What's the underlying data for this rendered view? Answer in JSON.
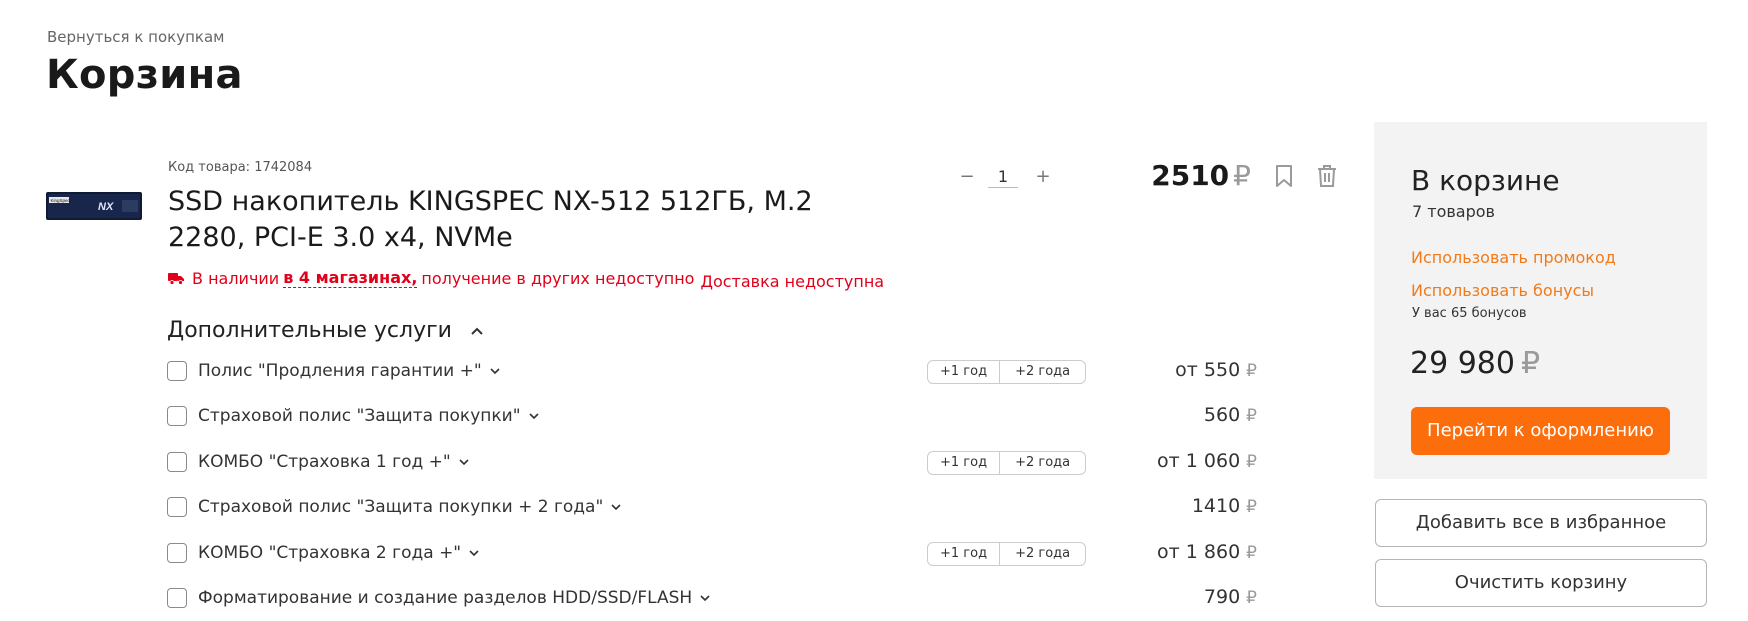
{
  "header": {
    "back_link": "Вернуться к покупкам",
    "title": "Корзина"
  },
  "product": {
    "code": "Код товара: 1742084",
    "name": "SSD накопитель KINGSPEC NX-512 512ГБ, M.2 2280, PCI-E 3.0 x4, NVMe",
    "availability": {
      "prefix": "В наличии",
      "stores_link": "в 4 магазинах,",
      "suffix": "получение в других недоступно",
      "delivery": "Доставка недоступна"
    },
    "image_brand": "KingSpec",
    "image_model": "NX",
    "quantity": "1",
    "qty_minus": "−",
    "qty_plus": "+",
    "price": "2510",
    "currency": "₽"
  },
  "services": {
    "title": "Дополнительные услуги",
    "items": [
      {
        "label": "Полис \"Продления гарантии +\"",
        "options": [
          "+1 год",
          "+2 года"
        ],
        "price": "от 550"
      },
      {
        "label": "Страховой полис \"Защита покупки\"",
        "options": [],
        "price": "560"
      },
      {
        "label": "КОМБО \"Страховка 1 год +\"",
        "options": [
          "+1 год",
          "+2 года"
        ],
        "price": "от 1 060"
      },
      {
        "label": "Страховой полис \"Защита покупки + 2 года\"",
        "options": [],
        "price": "1410"
      },
      {
        "label": "КОМБО \"Страховка 2 года +\"",
        "options": [
          "+1 год",
          "+2 года"
        ],
        "price": "от 1 860"
      },
      {
        "label": "Форматирование и создание разделов HDD/SSD/FLASH",
        "options": [],
        "price": "790"
      }
    ]
  },
  "summary": {
    "title": "В корзине",
    "count": "7 товаров",
    "promo_link": "Использовать промокод",
    "bonus_link": "Использовать бонусы",
    "bonus_info": "У вас 65 бонусов",
    "total": "29 980",
    "checkout_button": "Перейти к оформлению",
    "favorite_all_button": "Добавить все в избранное",
    "clear_button": "Очистить корзину"
  },
  "colors": {
    "accent": "#fc6d0c",
    "link": "#f27a1a",
    "stock_red": "#e0001a",
    "sidebar_bg": "#f3f3f3"
  },
  "icons": [
    "truck-icon",
    "bookmark-icon",
    "trash-icon",
    "chevron-up-icon",
    "chevron-down-icon"
  ]
}
